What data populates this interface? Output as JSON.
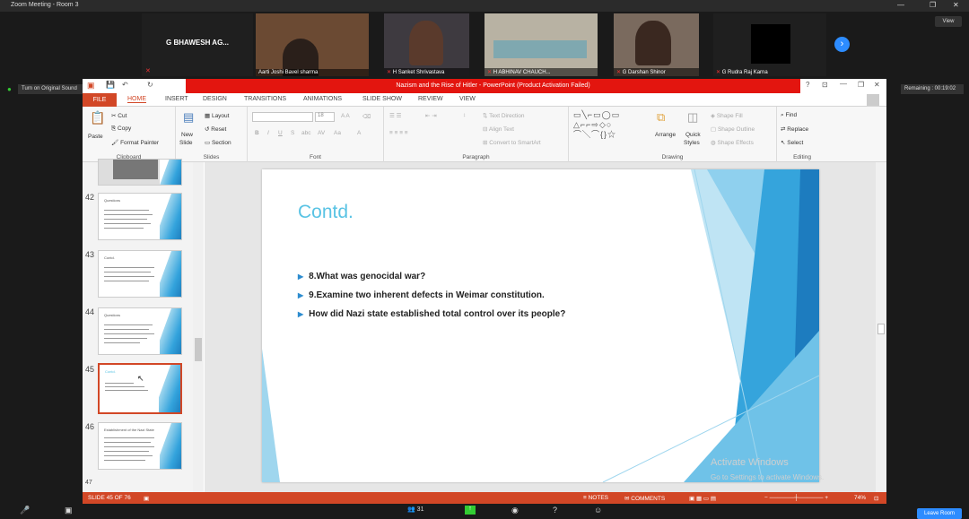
{
  "zoom": {
    "window_title": "Zoom Meeting - Room 3",
    "view_label": "View",
    "participants": [
      {
        "name": "G BHAWESH AG..."
      },
      {
        "name": "Aarti Joshi Bavel sharma"
      },
      {
        "name": "H Sanket Shrivastava"
      },
      {
        "name": "H ABHINAV CHAUCH..."
      },
      {
        "name": "G Darshan Shinor"
      },
      {
        "name": "G Rudra Raj Karna"
      }
    ],
    "audio_label": "Turn on Original Sound",
    "remaining_label": "Remaining : 00:19:02",
    "participants_count": "31",
    "leave_label": "Leave Room"
  },
  "ppt": {
    "title": "Nazism and the Rise of Hitler -  PowerPoint (Product Activation Failed)",
    "tabs": [
      "FILE",
      "HOME",
      "INSERT",
      "DESIGN",
      "TRANSITIONS",
      "ANIMATIONS",
      "SLIDE SHOW",
      "REVIEW",
      "VIEW"
    ],
    "ribbon": {
      "paste": "Paste",
      "cut": "Cut",
      "copy": "Copy",
      "format_painter": "Format Painter",
      "clipboard": "Clipboard",
      "new_slide": "New",
      "new_slide2": "Slide",
      "layout": "Layout",
      "reset": "Reset",
      "section": "Section",
      "slides": "Slides",
      "font_size": "18",
      "font_group": "Font",
      "text_direction": "Text Direction",
      "align_text": "Align Text",
      "convert_smartart": "Convert to SmartArt",
      "paragraph": "Paragraph",
      "arrange": "Arrange",
      "quick_styles": "Quick",
      "quick_styles2": "Styles",
      "shape_fill": "Shape Fill",
      "shape_outline": "Shape Outline",
      "shape_effects": "Shape Effects",
      "drawing": "Drawing",
      "find": "Find",
      "replace": "Replace",
      "select": "Select",
      "editing": "Editing"
    },
    "thumbnails": [
      {
        "num": "42",
        "title": "Questions"
      },
      {
        "num": "43",
        "title": "Contd."
      },
      {
        "num": "44",
        "title": "Questions"
      },
      {
        "num": "45",
        "title": "Contd."
      },
      {
        "num": "46",
        "title": "Establishment of the Nazi State"
      },
      {
        "num": "47",
        "title": ""
      }
    ],
    "slide": {
      "title": "Contd.",
      "bullets": [
        "8.What was genocidal war?",
        "9.Examine two inherent defects in Weimar constitution.",
        "How did Nazi state established total control over its people?"
      ]
    },
    "status": {
      "slide_of": "SLIDE 45 OF 76",
      "notes": "NOTES",
      "comments": "COMMENTS",
      "zoom": "74%"
    },
    "watermark": "Activate Windows",
    "watermark2": "Go to Settings to activate Windows."
  },
  "colors": {
    "accent_red": "#e3150f",
    "file_tab": "#d24726",
    "slide_title": "#59c3e4",
    "zoom_blue": "#2d8cff"
  }
}
